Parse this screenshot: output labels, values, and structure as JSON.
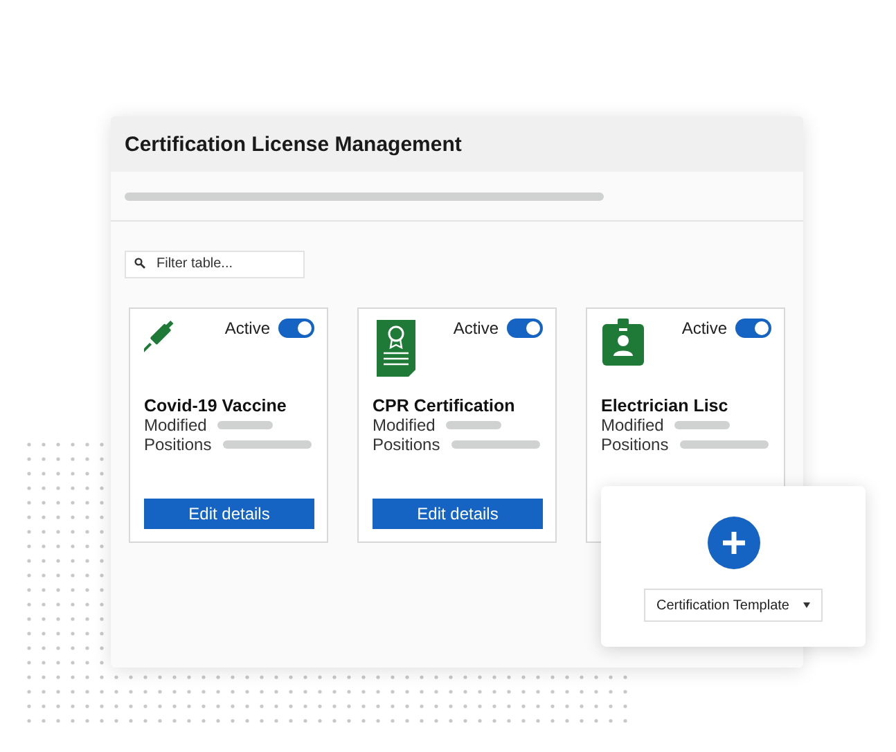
{
  "window": {
    "title": "Certification License Management"
  },
  "filter": {
    "placeholder": "Filter table..."
  },
  "cards": [
    {
      "status_label": "Active",
      "active": true,
      "title": "Covid-19 Vaccine",
      "modified_label": "Modified",
      "positions_label": "Positions",
      "button": "Edit details"
    },
    {
      "status_label": "Active",
      "active": true,
      "title": "CPR Certification",
      "modified_label": "Modified",
      "positions_label": "Positions",
      "button": "Edit details"
    },
    {
      "status_label": "Active",
      "active": true,
      "title": "Electrician Lisc",
      "modified_label": "Modified",
      "positions_label": "Positions"
    }
  ],
  "add_panel": {
    "template_select": "Certification Template"
  }
}
